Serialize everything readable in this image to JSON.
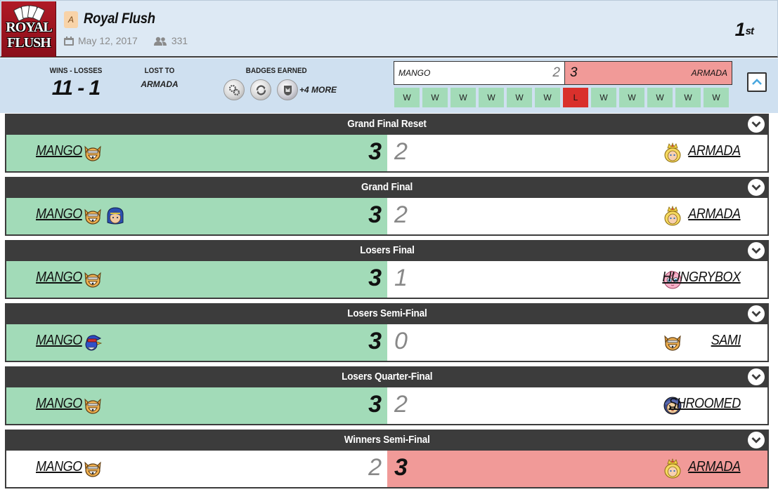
{
  "tournament": {
    "logo_text_1": "ROYAL",
    "logo_text_2": "FLUSH",
    "tier": "A",
    "name": "Royal Flush",
    "date": "May 12, 2017",
    "entrants": "331",
    "placing": "1",
    "placing_suffix": "st"
  },
  "summary": {
    "wins_losses_label": "WINS - LOSSES",
    "wins_losses": "11 - 1",
    "lost_to_label": "LOST TO",
    "lost_to": "ARMADA",
    "badges_label": "BADGES EARNED",
    "badges": [
      "gears-badge",
      "refresh-badge",
      "crest-badge"
    ],
    "more_badges": "+4 MORE"
  },
  "grand_final_box": {
    "left_name": "MANGO",
    "left_score": "2",
    "right_score": "3",
    "right_name": "ARMADA"
  },
  "streak": [
    "W",
    "W",
    "W",
    "W",
    "W",
    "W",
    "L",
    "W",
    "W",
    "W",
    "W",
    "W"
  ],
  "colors": {
    "win_green": "#a2dbb8",
    "loss_red": "#f19a98",
    "loss_cell": "#d9302c",
    "header_dark": "#3c3c3c",
    "header_bg": "#dde9f4"
  },
  "sets": [
    {
      "round": "Grand Final Reset",
      "p1": "MANGO",
      "p1_chars": [
        "fox-icon"
      ],
      "p1_score": "3",
      "p2": "ARMADA",
      "p2_chars": [
        "peach-icon"
      ],
      "p2_score": "2",
      "winner": "p1"
    },
    {
      "round": "Grand Final",
      "p1": "MANGO",
      "p1_chars": [
        "fox-icon",
        "marth-icon"
      ],
      "p1_score": "3",
      "p2": "ARMADA",
      "p2_chars": [
        "peach-icon"
      ],
      "p2_score": "2",
      "winner": "p1"
    },
    {
      "round": "Losers Final",
      "p1": "MANGO",
      "p1_chars": [
        "fox-icon"
      ],
      "p1_score": "3",
      "p2": "HUNGRYBOX",
      "p2_chars": [
        "jigglypuff-icon"
      ],
      "p2_score": "1",
      "winner": "p1"
    },
    {
      "round": "Losers Semi-Final",
      "p1": "MANGO",
      "p1_chars": [
        "falco-icon"
      ],
      "p1_score": "3",
      "p2": "SAMI",
      "p2_chars": [
        "fox-icon"
      ],
      "p2_score": "0",
      "winner": "p1"
    },
    {
      "round": "Losers Quarter-Final",
      "p1": "MANGO",
      "p1_chars": [
        "fox-icon"
      ],
      "p1_score": "3",
      "p2": "SHROOMED",
      "p2_chars": [
        "icclimbers-icon"
      ],
      "p2_score": "2",
      "winner": "p1"
    },
    {
      "round": "Winners Semi-Final",
      "p1": "MANGO",
      "p1_chars": [
        "fox-icon"
      ],
      "p1_score": "2",
      "p2": "ARMADA",
      "p2_chars": [
        "peach-icon"
      ],
      "p2_score": "3",
      "winner": "p2"
    }
  ]
}
